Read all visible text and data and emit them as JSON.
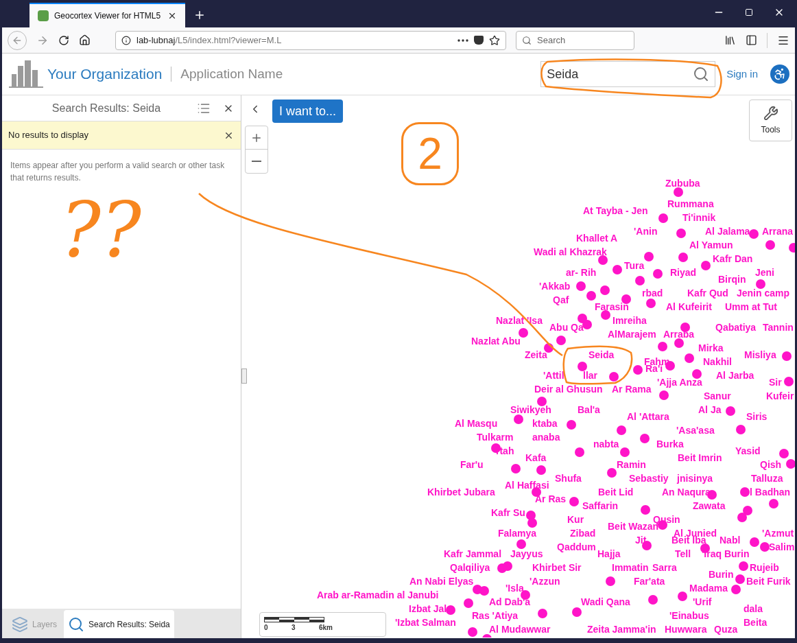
{
  "browser": {
    "tab_title": "Geocortex Viewer for HTML5",
    "url_host": "lab-lubnaj",
    "url_path": "/L5/index.html?viewer=M.L",
    "search_placeholder": "Search"
  },
  "header": {
    "organization": "Your Organization",
    "application": "Application Name",
    "search_value": "Seida",
    "sign_in": "Sign in"
  },
  "panel": {
    "title": "Search Results: Seida",
    "notice": "No results to display",
    "message": "Items appear after you perform a valid search or other task that returns results."
  },
  "panel_tabs": [
    {
      "label": "Layers",
      "selected": false
    },
    {
      "label": "Search Results: Seida",
      "selected": true
    }
  ],
  "map": {
    "i_want_to": "I want to...",
    "tools": "Tools",
    "scale_labels": [
      "0",
      "3",
      "6km"
    ],
    "places": [
      "Zububa",
      "Rummana",
      "At Tayba - Jen",
      "Ti'innik",
      "'Anin",
      "Al Jalama",
      "Arrana",
      "Khallet A",
      "Al Yamun",
      "Wadi al Khazrak",
      "Kafr Dan",
      "Tura",
      "ar- Rih",
      "Riyad",
      "Jeni",
      "Birqin",
      "'Akkab",
      "rbad",
      "Kafr Qud",
      "Jenin camp",
      "Qaf",
      "Farasin",
      "Al Kufeirit",
      "Umm at Tut",
      "Nazlat 'Isa",
      "Imreiha",
      "Abu Qa",
      "Qabatiya",
      "Tannin",
      "AlMarajem",
      "Arraba",
      "Nazlat Abu",
      "Mirka",
      "Zeita",
      "Seida",
      "Misliya",
      "Fahm",
      "Nakhil",
      "Ra'i",
      "'Attil",
      "llar",
      "Al Jarba",
      "'Ajja Anza",
      "Sir",
      "Deir al Ghusun",
      "Ar Rama",
      "Sanur",
      "Kufeir",
      "Siwikyeh",
      "Bal'a",
      "Al Ja",
      "Al 'Attara",
      "Siris",
      "Al Masqu",
      "ktaba",
      "'Asa'asa",
      "Tulkarm",
      "anaba",
      "nabta",
      "Burka",
      "rtah",
      "Yasid",
      "Kafa",
      "Beit Imrin",
      "Far'u",
      "Ramin",
      "Qish",
      "Shufa",
      "Sebastiy",
      "jnisinya",
      "Talluza",
      "Al Haffasi",
      "Khirbet Jubara",
      "Beit Lid",
      "An Naqura",
      "l Badhan",
      "Ar Ras",
      "Saffarin",
      "Zawata",
      "Kafr Su",
      "Kur",
      "Qusin",
      "Beit Wazan",
      "Falamya",
      "Zibad",
      "Al Junied",
      "'Azmut",
      "Jit",
      "Beit Iba",
      "Nabl",
      "Qaddum",
      "Salim",
      "Kafr Jammal",
      "Jayyus",
      "Hajja",
      "Tell",
      "'Iraq Burin",
      "Qalqiliya",
      "Khirbet Sir",
      "Immatin",
      "Sarra",
      "Rujeib",
      "Burin",
      "An Nabi Elyas",
      "'Azzun",
      "Far'ata",
      "Beit Furik",
      "'Isla",
      "Madama",
      "Arab ar-Ramadin al Janubi",
      "Ad Dab'a",
      "Wadi Qana",
      "'Urif",
      "Izbat Jal",
      "dala",
      "Ras 'Atiya",
      "'Einabus",
      "'Izbat Salman",
      "Beita",
      "Al Mudawwar",
      "Zeita Jamma'in",
      "Huwwara",
      "Quza"
    ]
  },
  "annotations": {
    "circled_number": "2",
    "question_marks": "??"
  }
}
